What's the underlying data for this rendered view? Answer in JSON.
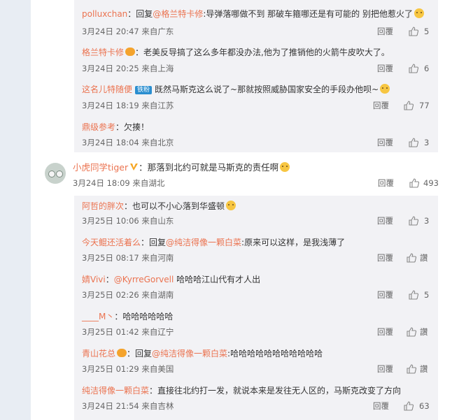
{
  "accent_color": "#eb7350",
  "main_comment": {
    "author": "小虎同学tiger",
    "text": "：那落到北约可就是马斯克的责任啊",
    "time": "3月24日 18:09 来自湖北",
    "reply_label": "回覆",
    "likes": "493"
  },
  "upper_replies": [
    {
      "author": "polluxchan",
      "prefix": "：回复",
      "mention": "@格兰特卡修",
      "text": ":导弹落哪做不到 那破车箍哪还是有可能的 别把他惹火了",
      "time": "3月24日 20:47 来自广东",
      "reply_label": "回覆",
      "likes": "5"
    },
    {
      "author": "格兰特卡修",
      "prefix": "",
      "mention": "",
      "text": "：老美反导搞了这么多年都没办法,他为了推销他的火箭牛皮吹大了。",
      "time": "3月24日 20:25 来自上海",
      "reply_label": "回覆",
      "likes": "6"
    },
    {
      "author": "这名儿特随便",
      "badge": "铁粉",
      "prefix": "",
      "mention": "",
      "text": "既然马斯克这么说了~那就按照威胁国家安全的手段办他呗~",
      "time": "3月24日 18:19 来自江苏",
      "reply_label": "回覆",
      "likes": "77"
    },
    {
      "author": "鼎级参考",
      "prefix": "",
      "mention": "",
      "text": "：欠揍！",
      "time": "3月24日 18:04 来自北京",
      "reply_label": "回覆",
      "likes": "3"
    }
  ],
  "lower_replies": [
    {
      "author": "阿哲的胖次",
      "prefix": "",
      "mention": "",
      "text": "：也可以不小心落到华盛顿",
      "time": "3月25日 10:06 来自山东",
      "reply_label": "回覆",
      "likes": "3"
    },
    {
      "author": "今天鲲还活着么",
      "prefix": "：回复",
      "mention": "@纯洁得像一颗白菜",
      "text": ":原来可以这样，是我浅薄了",
      "time": "3月25日 08:17 来自河南",
      "reply_label": "回覆",
      "likes": "讚"
    },
    {
      "author": "婧Vivi",
      "prefix": "：",
      "mention": "@KyrreGorvell",
      "text": " 哈哈哈江山代有才人出",
      "time": "3月25日 02:26 来自湖南",
      "reply_label": "回覆",
      "likes": "5"
    },
    {
      "author": "____M丶",
      "prefix": "",
      "mention": "",
      "text": "：哈哈哈哈哈哈",
      "time": "3月25日 01:42 来自辽宁",
      "reply_label": "回覆",
      "likes": "讚"
    },
    {
      "author": "青山花总",
      "prefix": "：回复",
      "mention": "@纯洁得像一颗白菜",
      "text": ":哈哈哈哈哈哈哈哈哈哈哈",
      "time": "3月25日 01:29 来自美国",
      "reply_label": "回覆",
      "likes": "讚"
    },
    {
      "author": "纯洁得像一颗白菜",
      "prefix": "",
      "mention": "",
      "text": "：直接往北约打一发，就说本来是发往无人区的，马斯克改变了方向",
      "time": "3月24日 21:54 来自吉林",
      "reply_label": "回覆",
      "likes": "63"
    }
  ]
}
